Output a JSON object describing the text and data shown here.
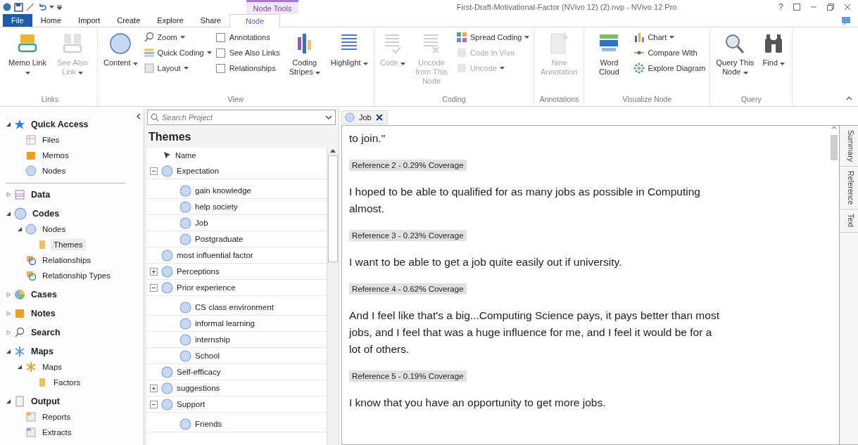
{
  "title_bar": {
    "context_tab": "Node Tools",
    "title": "First-Draft-Motivational-Factor (NVivo 12) (2).nvp - NVivo 12 Pro",
    "help": "?"
  },
  "ribbon_tabs": [
    {
      "label": "File",
      "kind": "file",
      "selected": false
    },
    {
      "label": "Home",
      "kind": "tab",
      "selected": false
    },
    {
      "label": "Import",
      "kind": "tab",
      "selected": false
    },
    {
      "label": "Create",
      "kind": "tab",
      "selected": false
    },
    {
      "label": "Explore",
      "kind": "tab",
      "selected": false
    },
    {
      "label": "Share",
      "kind": "tab",
      "selected": false
    },
    {
      "label": "Node",
      "kind": "tab",
      "selected": true
    }
  ],
  "ribbon_groups": [
    {
      "label": "Links",
      "items": [
        {
          "kind": "large",
          "label": "Memo Link",
          "dropdown": true,
          "disabled": false
        },
        {
          "kind": "large",
          "label": "See Also Link",
          "dropdown": true,
          "disabled": true
        }
      ]
    },
    {
      "label": "View",
      "items": [
        {
          "kind": "large",
          "label": "Content",
          "dropdown": true,
          "disabled": false
        },
        {
          "kind": "stack",
          "entries": [
            {
              "kind": "small",
              "label": "Zoom",
              "dropdown": true,
              "disabled": false
            },
            {
              "kind": "small",
              "label": "Quick Coding",
              "dropdown": true,
              "disabled": false
            },
            {
              "kind": "small",
              "label": "Layout",
              "dropdown": true,
              "disabled": false
            }
          ]
        },
        {
          "kind": "stack",
          "entries": [
            {
              "kind": "check",
              "label": "Annotations",
              "checked": false
            },
            {
              "kind": "check",
              "label": "See Also Links",
              "checked": false
            },
            {
              "kind": "check",
              "label": "Relationships",
              "checked": false
            }
          ]
        },
        {
          "kind": "large",
          "label": "Coding Stripes",
          "dropdown": true,
          "disabled": false
        },
        {
          "kind": "large",
          "label": "Highlight",
          "dropdown": true,
          "disabled": false
        }
      ]
    },
    {
      "label": "Coding",
      "items": [
        {
          "kind": "large",
          "label": "Code",
          "dropdown": true,
          "disabled": true
        },
        {
          "kind": "large",
          "label": "Uncode from This Node",
          "dropdown": false,
          "disabled": true
        },
        {
          "kind": "stack",
          "entries": [
            {
              "kind": "small",
              "label": "Spread Coding",
              "dropdown": true,
              "disabled": false
            },
            {
              "kind": "small",
              "label": "Code In Vivo",
              "dropdown": false,
              "disabled": true
            },
            {
              "kind": "small",
              "label": "Uncode",
              "dropdown": true,
              "disabled": true
            }
          ]
        }
      ]
    },
    {
      "label": "Annotations",
      "items": [
        {
          "kind": "large",
          "label": "New Annotation",
          "dropdown": false,
          "disabled": true
        }
      ]
    },
    {
      "label": "Visualize Node",
      "items": [
        {
          "kind": "large",
          "label": "Word Cloud",
          "dropdown": false,
          "disabled": false
        },
        {
          "kind": "stack",
          "entries": [
            {
              "kind": "small",
              "label": "Chart",
              "dropdown": true,
              "disabled": false
            },
            {
              "kind": "small",
              "label": "Compare With",
              "dropdown": false,
              "disabled": false
            },
            {
              "kind": "small",
              "label": "Explore Diagram",
              "dropdown": false,
              "disabled": false
            }
          ]
        }
      ]
    },
    {
      "label": "Query",
      "items": [
        {
          "kind": "large",
          "label": "Query This Node",
          "dropdown": true,
          "disabled": false
        },
        {
          "kind": "large",
          "label": "Find",
          "dropdown": true,
          "disabled": false
        }
      ]
    }
  ],
  "navigation": [
    {
      "label": "Quick Access",
      "kind": "pinned",
      "expanded": true,
      "selected": false,
      "children": [
        {
          "label": "Files",
          "selected": false
        },
        {
          "label": "Memos",
          "selected": false
        },
        {
          "label": "Nodes",
          "selected": false
        }
      ]
    },
    {
      "label": "Data",
      "expanded": false,
      "selected": false
    },
    {
      "label": "Codes",
      "expanded": true,
      "selected": false,
      "children": [
        {
          "label": "Nodes",
          "expanded": true,
          "selected": false,
          "children": [
            {
              "label": "Themes",
              "selected": true
            }
          ]
        },
        {
          "label": "Relationships",
          "selected": false
        },
        {
          "label": "Relationship Types",
          "selected": false
        }
      ]
    },
    {
      "label": "Cases",
      "expanded": false,
      "selected": false
    },
    {
      "label": "Notes",
      "expanded": false,
      "selected": false
    },
    {
      "label": "Search",
      "expanded": false,
      "selected": false
    },
    {
      "label": "Maps",
      "expanded": true,
      "selected": false,
      "children": [
        {
          "label": "Maps",
          "expanded": true,
          "selected": false,
          "children": [
            {
              "label": "Factors",
              "selected": false
            }
          ]
        }
      ]
    },
    {
      "label": "Output",
      "expanded": true,
      "selected": false,
      "children": [
        {
          "label": "Reports",
          "selected": false
        },
        {
          "label": "Extracts",
          "selected": false
        }
      ]
    }
  ],
  "search": {
    "placeholder": "Search Project"
  },
  "list": {
    "title": "Themes",
    "column": "Name",
    "items": [
      {
        "label": "Expectation",
        "expanded": true,
        "children": [
          {
            "label": "gain knowledge"
          },
          {
            "label": "help society"
          },
          {
            "label": "Job"
          },
          {
            "label": "Postgraduate"
          }
        ]
      },
      {
        "label": "most influential  factor"
      },
      {
        "label": "Perceptions",
        "expanded": false
      },
      {
        "label": "Prior experience",
        "expanded": true,
        "children": [
          {
            "label": "CS class environment"
          },
          {
            "label": "informal learning"
          },
          {
            "label": "internship"
          },
          {
            "label": "School"
          }
        ]
      },
      {
        "label": "Self-efficacy"
      },
      {
        "label": "suggestions",
        "expanded": false
      },
      {
        "label": "Support",
        "expanded": true,
        "children": [
          {
            "label": "Friends"
          }
        ]
      }
    ]
  },
  "detail": {
    "tab": "Job",
    "content": [
      {
        "kind": "text",
        "text": "to join.\""
      },
      {
        "kind": "reference",
        "text": "Reference 2 - 0.29% Coverage"
      },
      {
        "kind": "text",
        "text": "I hoped to be able to qualified for as many jobs as possible in Computing almost."
      },
      {
        "kind": "reference",
        "text": "Reference 3 - 0.23% Coverage"
      },
      {
        "kind": "text",
        "text": " I want to be able to get a job quite easily out if university."
      },
      {
        "kind": "reference",
        "text": "Reference 4 - 0.62% Coverage"
      },
      {
        "kind": "text",
        "text": "And I feel like that's a big...Computing Science pays, it pays better than most jobs, and I feel that was a huge influence for me, and I feel it would be for a lot of others."
      },
      {
        "kind": "reference",
        "text": "Reference 5 - 0.19% Coverage"
      },
      {
        "kind": "text",
        "text": "I know that you have an opportunity to get more jobs."
      }
    ],
    "side_tabs": [
      "Summary",
      "Reference",
      "Text"
    ]
  }
}
